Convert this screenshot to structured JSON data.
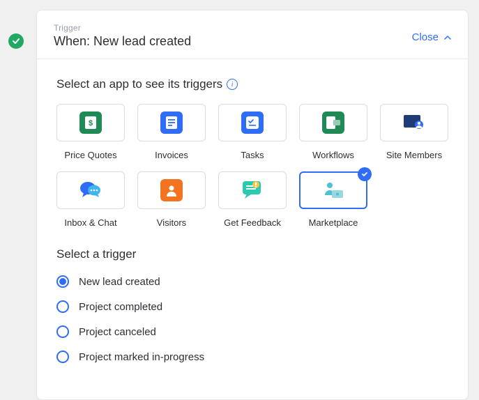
{
  "header": {
    "kicker": "Trigger",
    "title": "When: New lead created",
    "close_label": "Close"
  },
  "sections": {
    "apps_label": "Select an app to see its triggers",
    "triggers_label": "Select a trigger"
  },
  "apps": [
    {
      "id": "price-quotes",
      "label": "Price Quotes",
      "selected": false
    },
    {
      "id": "invoices",
      "label": "Invoices",
      "selected": false
    },
    {
      "id": "tasks",
      "label": "Tasks",
      "selected": false
    },
    {
      "id": "workflows",
      "label": "Workflows",
      "selected": false
    },
    {
      "id": "site-members",
      "label": "Site Members",
      "selected": false
    },
    {
      "id": "inbox-chat",
      "label": "Inbox & Chat",
      "selected": false
    },
    {
      "id": "visitors",
      "label": "Visitors",
      "selected": false
    },
    {
      "id": "get-feedback",
      "label": "Get Feedback",
      "selected": false
    },
    {
      "id": "marketplace",
      "label": "Marketplace",
      "selected": true
    }
  ],
  "triggers": [
    {
      "id": "new-lead",
      "label": "New lead created",
      "checked": true
    },
    {
      "id": "project-completed",
      "label": "Project completed",
      "checked": false
    },
    {
      "id": "project-canceled",
      "label": "Project canceled",
      "checked": false
    },
    {
      "id": "project-inprogress",
      "label": "Project marked in-progress",
      "checked": false
    }
  ],
  "colors": {
    "accent": "#2f6df6",
    "success": "#23a864"
  }
}
